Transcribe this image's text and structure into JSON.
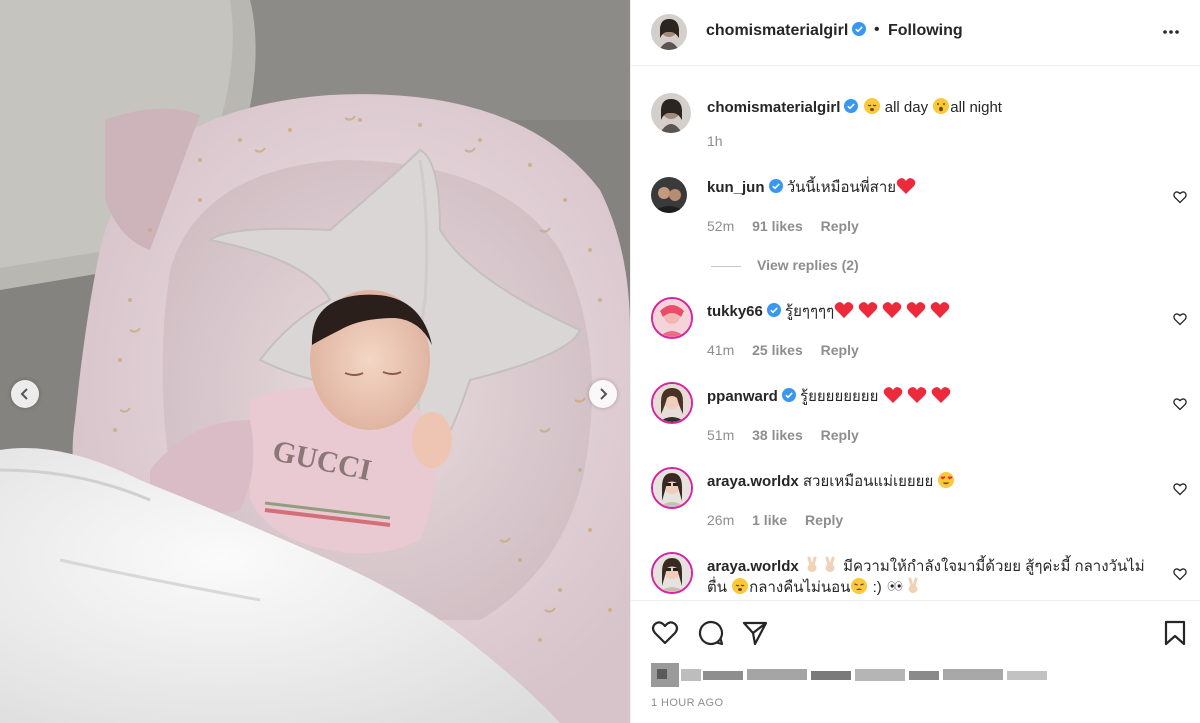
{
  "post": {
    "author": "chomismaterialgirl",
    "follow_status": "Following",
    "separator": "•",
    "caption_part1": "all day",
    "caption_part2": "all night",
    "caption_time": "1h",
    "timestamp": "1 HOUR AGO",
    "image_gucci_text": "GUCCI"
  },
  "comments": [
    {
      "user": "kun_jun",
      "text": "วันนี้เหมือนพี่สาย",
      "time": "52m",
      "likes": "91 likes",
      "reply": "Reply",
      "view_replies": "View replies (2)"
    },
    {
      "user": "tukky66",
      "text": "รู้ยๆๆๆๆ",
      "time": "41m",
      "likes": "25 likes",
      "reply": "Reply"
    },
    {
      "user": "ppanward",
      "text": "รู้ยยยยยยยย",
      "time": "51m",
      "likes": "38 likes",
      "reply": "Reply"
    },
    {
      "user": "araya.worldx",
      "text": "สวยเหมือนแม่เยยยย",
      "time": "26m",
      "likes": "1 like",
      "reply": "Reply"
    },
    {
      "user": "araya.worldx",
      "text_a": "มีความให้กำลังใจมามี้ด้วยย สู้ๆค่ะมี้ กลางวันไม่ตื่น",
      "text_b": "กลางคืนไม่นอน",
      "text_c": ":)"
    }
  ],
  "colors": {
    "verified": "#3897f0",
    "text": "#262626",
    "muted": "#8e8e8e",
    "heart_red": "#ed2a3c"
  },
  "icons": [
    "verified-icon",
    "more-icon",
    "heart-outline-icon",
    "comment-icon",
    "share-icon",
    "bookmark-icon",
    "chevron-left-icon",
    "chevron-right-icon"
  ]
}
